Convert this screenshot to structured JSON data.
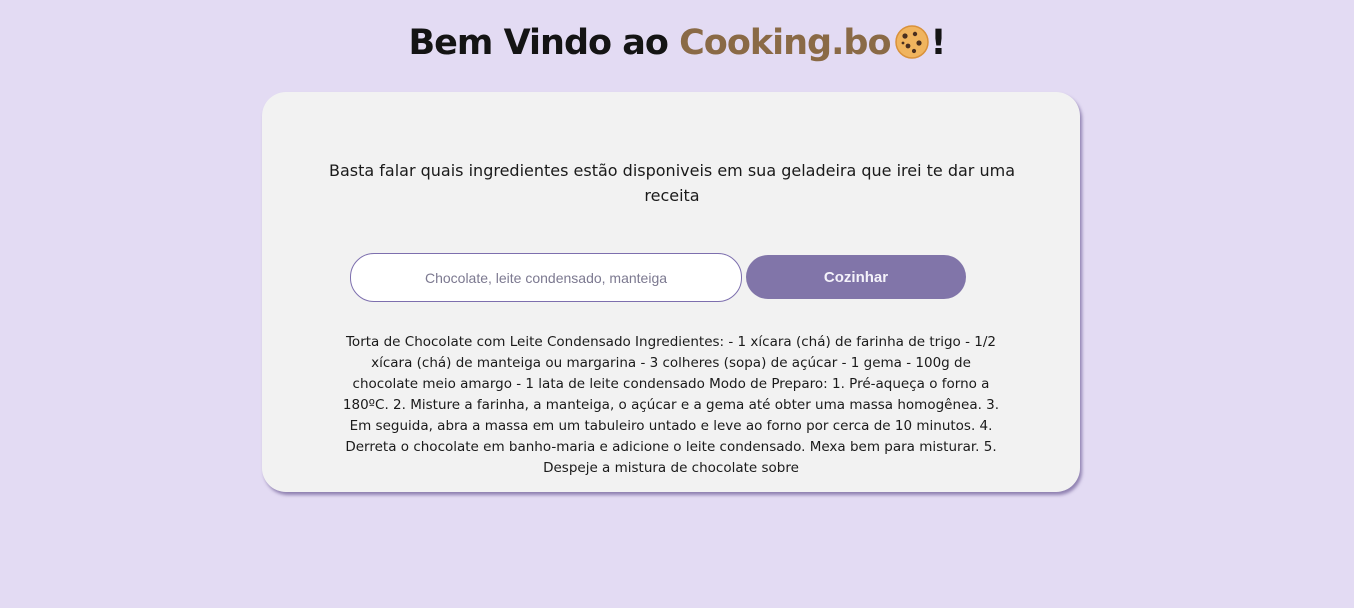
{
  "header": {
    "title_prefix": "Bem Vindo ao ",
    "brand": "Cooking.bo",
    "title_suffix": "!",
    "brand_color": "#8a6a46",
    "icon": "cookie-icon"
  },
  "card": {
    "intro": "Basta falar quais ingredientes estão disponiveis em sua geladeira que irei te dar uma receita",
    "input": {
      "value": "",
      "placeholder": "Chocolate, leite condensado, manteiga"
    },
    "button_label": "Cozinhar",
    "recipe": "Torta de Chocolate com Leite Condensado Ingredientes: - 1 xícara (chá) de farinha de trigo - 1/2 xícara (chá) de manteiga ou margarina - 3 colheres (sopa) de açúcar - 1 gema - 100g de chocolate meio amargo - 1 lata de leite condensado Modo de Preparo: 1. Pré-aqueça o forno a 180ºC. 2. Misture a farinha, a manteiga, o açúcar e a gema até obter uma massa homogênea. 3. Em seguida, abra a massa em um tabuleiro untado e leve ao forno por cerca de 10 minutos. 4. Derreta o chocolate em banho-maria e adicione o leite condensado. Mexa bem para misturar. 5. Despeje a mistura de chocolate sobre"
  },
  "colors": {
    "background": "#e3dbf3",
    "card": "#f2f2f2",
    "accent": "#8175a9"
  }
}
